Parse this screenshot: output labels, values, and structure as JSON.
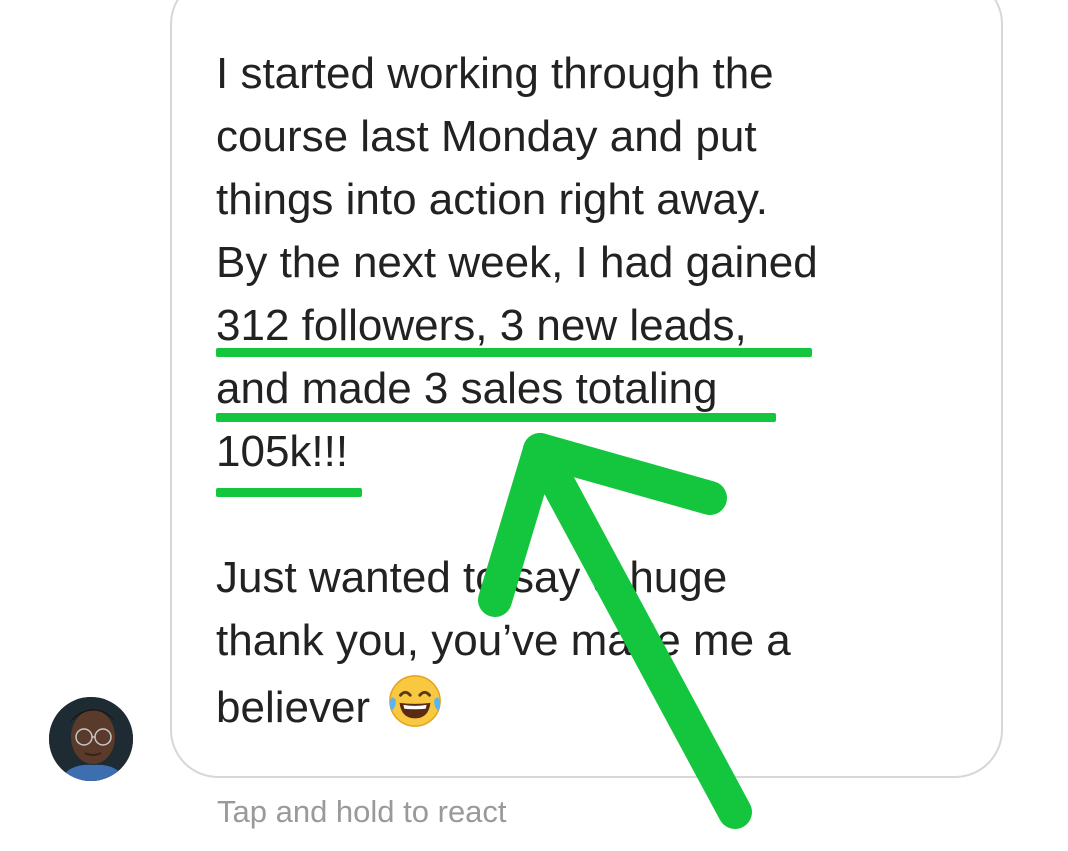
{
  "message": {
    "paragraph_1_lines": [
      "I started working through the",
      "course last Monday and put",
      "things into action right away.",
      "By the next week, I had gained",
      "312 followers, 3 new leads,",
      "and made 3 sales totaling",
      "105k!!!"
    ],
    "paragraph_2_lines": [
      "Just wanted to say a huge",
      "thank you, you’ve made me a",
      "believer"
    ],
    "emoji": "laughing-tears-emoji"
  },
  "caption": "Tap and hold to react",
  "colors": {
    "highlight": "#14c63e",
    "text": "#222222",
    "caption": "#9a9a9a",
    "bubble_border": "#d7d7d7"
  }
}
